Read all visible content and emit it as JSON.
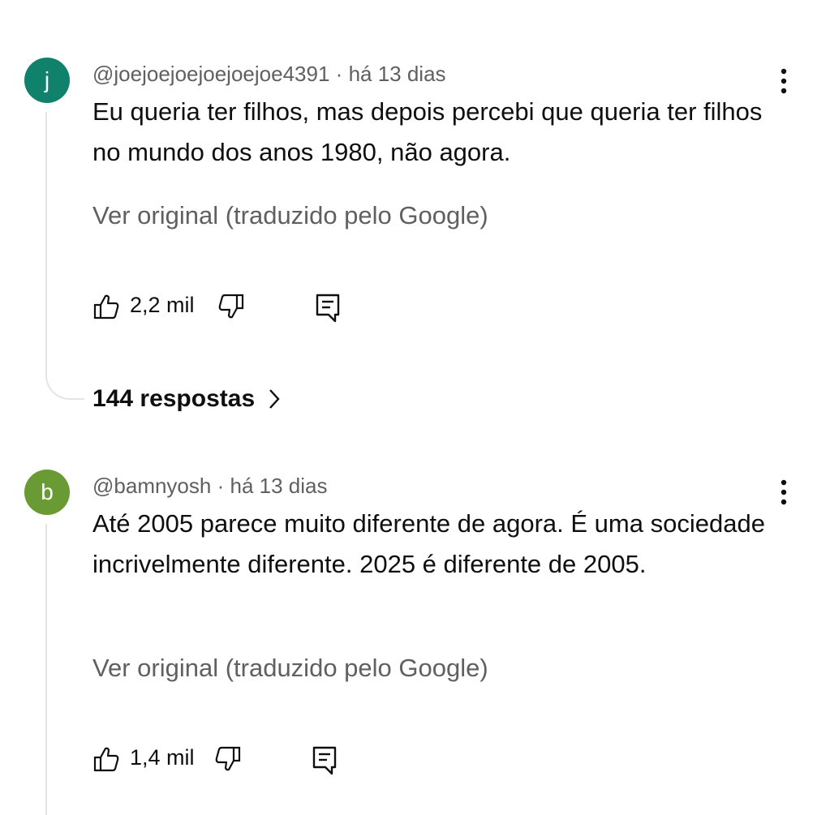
{
  "colors": {
    "avatar_j": "#10816b",
    "avatar_b": "#6a9a34",
    "meta_text": "#606060",
    "primary_text": "#0f0f0f"
  },
  "comments": [
    {
      "avatar_letter": "j",
      "author": "@joejoejoejoejoejoe4391",
      "separator": "·",
      "time": "há 13 dias",
      "text": "Eu queria ter filhos, mas depois percebi que queria ter filhos no mundo dos anos 1980, não agora.",
      "translate_label": "Ver original (traduzido pelo Google)",
      "likes": "2,2 mil",
      "replies": "144 respostas",
      "icons": [
        "like-icon",
        "dislike-icon",
        "reply-icon",
        "more-vert-icon",
        "chevron-right-icon"
      ]
    },
    {
      "avatar_letter": "b",
      "author": "@bamnyosh",
      "separator": "·",
      "time": "há 13 dias",
      "text": "Até 2005 parece muito diferente de agora. É uma sociedade incrivelmente diferente. 2025 é diferente de 2005.",
      "translate_label": "Ver original (traduzido pelo Google)",
      "likes": "1,4 mil",
      "icons": [
        "like-icon",
        "dislike-icon",
        "reply-icon",
        "more-vert-icon"
      ]
    }
  ]
}
